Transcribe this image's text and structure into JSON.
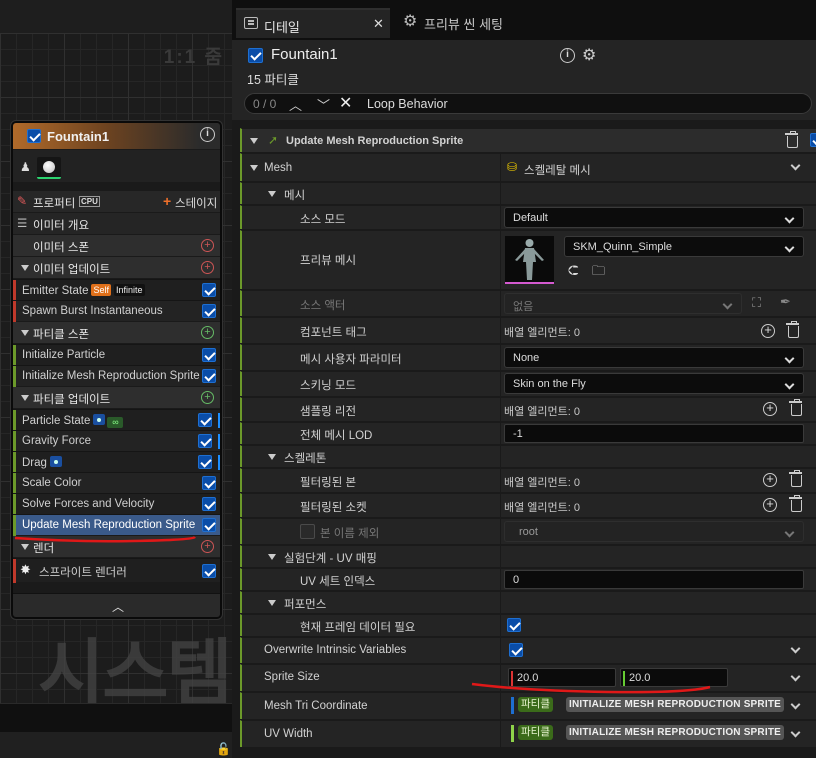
{
  "graph": {
    "zoom_label": "1:1 줌",
    "watermark": "시스템"
  },
  "node": {
    "title": "Fountain1",
    "properties_label": "프로퍼티",
    "cpu_badge": "CPU",
    "stage_label": "스테이지",
    "emitter_overview": "이미터 개요",
    "emitter_spawn": "이미터 스폰",
    "emitter_update": "이미터 업데이트",
    "emitter_state": "Emitter State",
    "self_badge": "Self",
    "infinite_badge": "Infinite",
    "spawn_burst": "Spawn Burst Instantaneous",
    "particle_spawn": "파티클 스폰",
    "init_particle": "Initialize Particle",
    "init_mesh_repro": "Initialize Mesh Reproduction Sprite",
    "particle_update": "파티클 업데이트",
    "particle_state": "Particle State",
    "gravity": "Gravity Force",
    "drag": "Drag",
    "scale_color": "Scale Color",
    "solve_forces": "Solve Forces and Velocity",
    "update_mesh_repro": "Update Mesh Reproduction Sprite",
    "render": "렌더",
    "sprite_renderer": "스프라이트 렌더러"
  },
  "tabs": {
    "details": "디테일",
    "preview_scene": "프리뷰 씬 세팅",
    "close_glyph": "✕"
  },
  "header": {
    "title": "Fountain1",
    "subtitle": "15 파티클",
    "search_count": "0 / 0",
    "search_query": "Loop Behavior"
  },
  "details": {
    "module_title": "Update Mesh Reproduction Sprite",
    "mesh_label": "Mesh",
    "mesh_value": "스켈레탈 메시",
    "mesh_cat": "메시",
    "source_mode_label": "소스 모드",
    "source_mode_value": "Default",
    "preview_mesh_label": "프리뷰 메시",
    "preview_mesh_value": "SKM_Quinn_Simple",
    "source_actor_label": "소스 액터",
    "source_actor_value": "없음",
    "component_tags_label": "컴포넌트 태그",
    "array_elements_0": "배열 엘리먼트: 0",
    "mesh_user_param_label": "메시 사용자 파라미터",
    "mesh_user_param_value": "None",
    "skinning_mode_label": "스키닝 모드",
    "skinning_mode_value": "Skin on the Fly",
    "sampling_region_label": "샘플링 리전",
    "whole_mesh_lod_label": "전체 메시 LOD",
    "whole_mesh_lod_value": "-1",
    "skeleton_cat": "스켈레톤",
    "filtered_bones_label": "필터링된 본",
    "filtered_sockets_label": "필터링된 소켓",
    "exclude_bone_label": "본 이름 제외",
    "exclude_bone_value": "root",
    "uv_cat": "실험단계 - UV 매핑",
    "uv_index_label": "UV 세트 인덱스",
    "uv_index_value": "0",
    "perf_cat": "퍼포먼스",
    "frame_data_label": "현재 프레임 데이터 필요",
    "overwrite_label": "Overwrite Intrinsic Variables",
    "sprite_size_label": "Sprite Size",
    "sprite_size_x": "20.0",
    "sprite_size_y": "20.0",
    "mesh_tri_label": "Mesh Tri Coordinate",
    "uv_width_label": "UV Width",
    "particle_chip": "파티클",
    "init_chip": "INITIALIZE MESH REPRODUCTION SPRITE"
  },
  "colors": {
    "accent_blue": "#0a4da8",
    "annotation_red": "#e01818",
    "node_header": "#b06a2a"
  }
}
